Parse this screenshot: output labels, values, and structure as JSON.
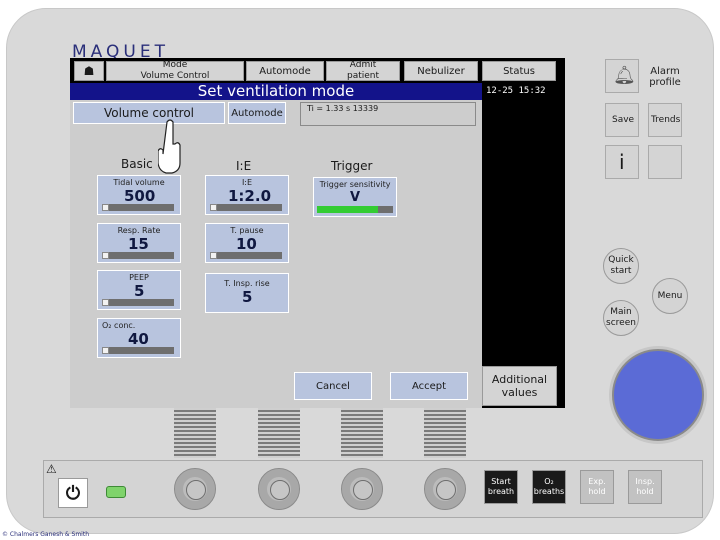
{
  "brand": {
    "logo": "MAQUET",
    "copyright": "© Chalmers Ganesh & Smith"
  },
  "topbar": {
    "mode_label": "Mode\nVolume Control",
    "automode": "Automode",
    "admit": "Admit\npatient",
    "nebulizer": "Nebulizer",
    "status": "Status",
    "alarm_profile": "Alarm\nprofile",
    "trends": "Trends",
    "save": "Save"
  },
  "banner": {
    "title": "Set ventilation mode"
  },
  "clock": "12-25 15:32",
  "mode_row": {
    "mode_select": "Volume control",
    "automode": "Automode",
    "info": "Ti = 1.33 s   13339"
  },
  "headers": {
    "basic": "Basic",
    "ie": "I:E",
    "trigger": "Trigger"
  },
  "tiles": [
    {
      "label": "Tidal volume",
      "value": "500"
    },
    {
      "label": "Resp. Rate",
      "value": "15"
    },
    {
      "label": "PEEP",
      "value": "5"
    },
    {
      "label": "O₂ conc.",
      "value": "40"
    },
    {
      "label": "I:E",
      "value": "1:2.0"
    },
    {
      "label": "T. pause",
      "value": "10"
    },
    {
      "label": "T. Insp. rise",
      "value": "5"
    },
    {
      "label": "Trigger sensitivity",
      "value": "V"
    }
  ],
  "actions": {
    "cancel": "Cancel",
    "accept": "Accept",
    "additional": "Additional\nvalues"
  },
  "side": {
    "info": "i",
    "quick_start": "Quick\nstart",
    "menu": "Menu",
    "main_screen": "Main\nscreen"
  },
  "bottom": {
    "start_breath": "Start\nbreath",
    "o2_breaths": "O₂\nbreaths",
    "exp_hold": "Exp.\nhold",
    "insp_hold": "Insp.\nhold"
  },
  "colors": {
    "banner": "#13138a",
    "tile": "#b8c4de",
    "knob": "#5b6bd6",
    "trigger_bar": "#33cc33"
  }
}
